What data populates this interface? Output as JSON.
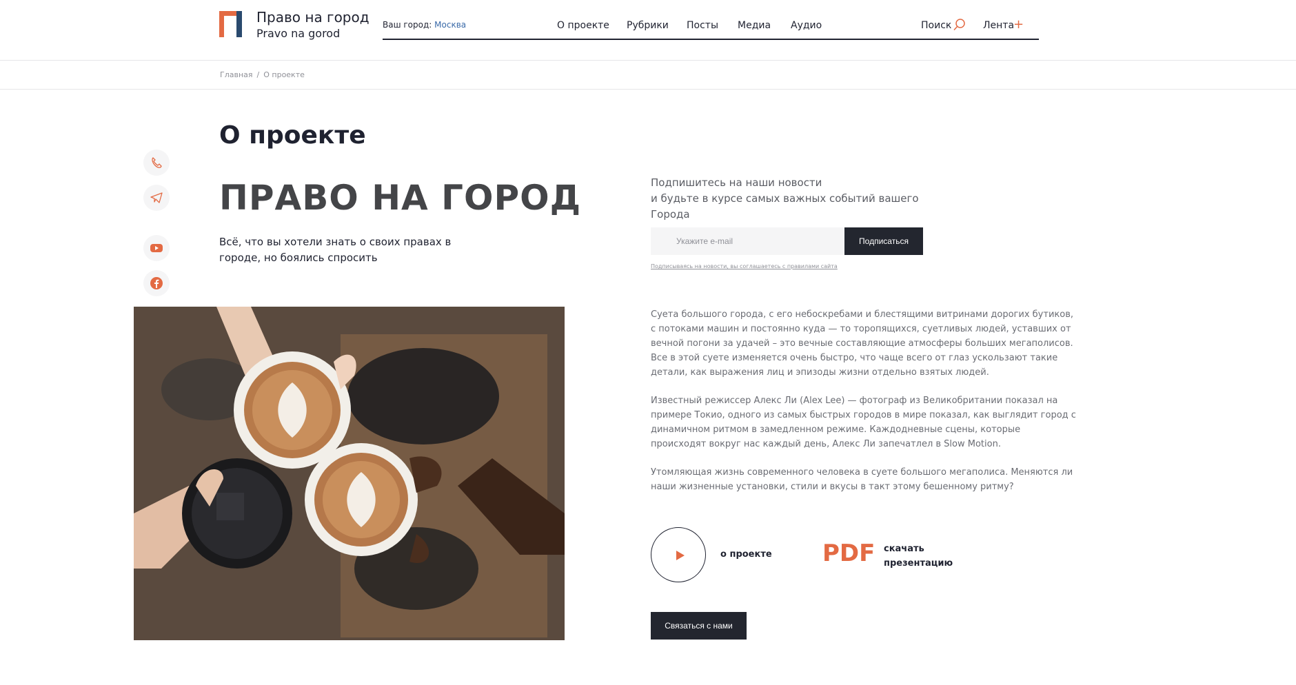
{
  "header": {
    "brand_ru": "Право на город",
    "brand_en": "Pravo na gorod",
    "city_label": "Ваш город:",
    "city_value": "Москва",
    "nav": [
      "О проекте",
      "Рубрики",
      "Посты",
      "Медиа",
      "Аудио"
    ],
    "search_label": "Поиск",
    "feed_label": "Лента",
    "feed_plus": "+"
  },
  "breadcrumb": [
    "Главная",
    "О проекте"
  ],
  "breadcrumb_sep": "/",
  "social_icons": [
    "phone-icon",
    "telegram-icon",
    "youtube-icon",
    "facebook-icon"
  ],
  "main": {
    "page_title": "О проекте",
    "hero_title": "ПРАВО НА ГОРОД",
    "subtitle": "Всё, что вы хотели знать о своих правах в городе, но боялись спросить"
  },
  "subscribe": {
    "text_line1": "Подпишитесь на наши новости",
    "text_line2": "и будьте в курсе самых важных событий вашего Города",
    "placeholder": "Укажите e-mail",
    "button": "Подписаться",
    "agree": "Подписываясь на новости, вы соглашаетесь с правилами сайта"
  },
  "paragraphs": [
    "Суета большого города, с его небоскребами и блестящими витринами дорогих бутиков, с потоками машин и постоянно куда — то торопящихся, суетливых людей, уставших от вечной погони за удачей – это вечные составляющие атмосферы больших мегаполисов. Все в этой суете изменяется очень быстро, что чаще всего от глаз ускользают такие детали, как выражения лиц и эпизоды жизни отдельно взятых людей.",
    "Известный режиссер Алекс Ли (Alex Lee) — фотограф из Великобритании показал на примере Токио, одного из самых быстрых городов в мире показал, как выглядит город с динамичном ритмом в замедленном режиме. Каждодневные сцены, которые происходят вокруг нас каждый день, Алекс Ли запечатлел в Slow Motion.",
    "Утомляющая жизнь современного человека в суете большого мегаполиса. Меняются ли наши жизненные установки, стили и вкусы в такт этому бешенному ритму?"
  ],
  "media": {
    "about_label": "о проекте",
    "pdf_text": "PDF",
    "pdf_label": "скачать презентацию"
  },
  "contact_button": "Связаться с нами",
  "colors": {
    "accent": "#e36a43",
    "dark": "#23262f",
    "link": "#3a6aa8"
  }
}
